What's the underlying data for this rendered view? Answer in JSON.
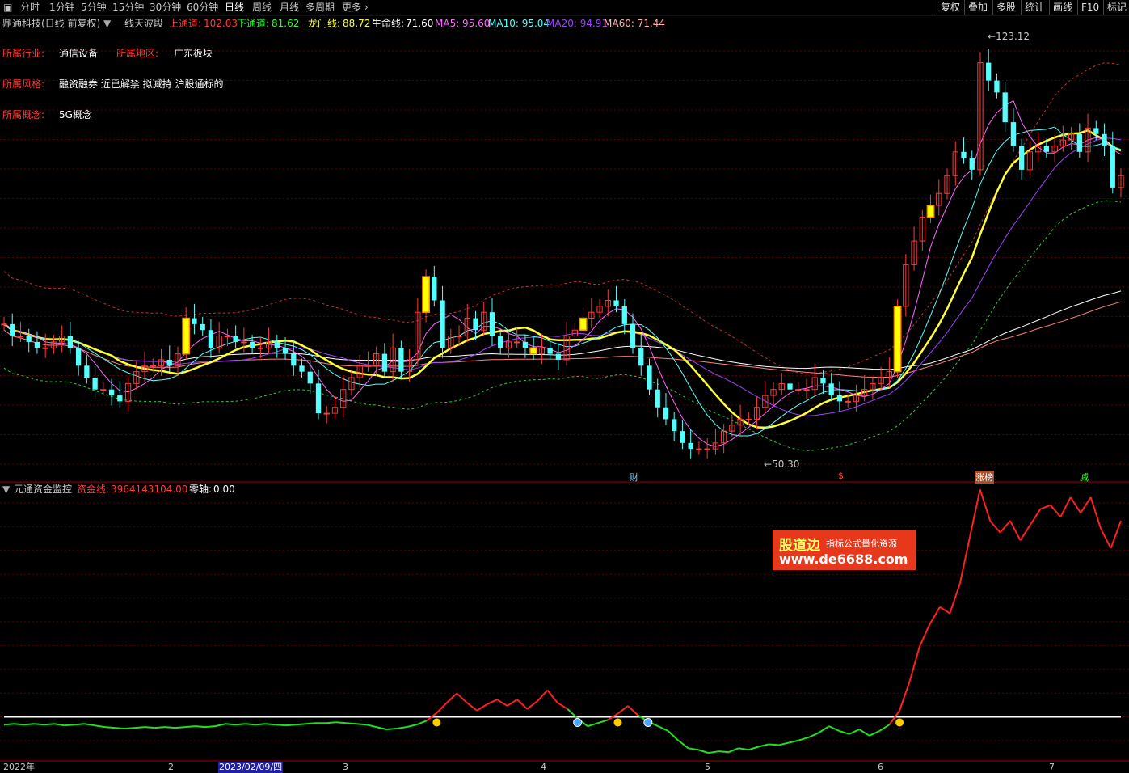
{
  "toolbar": {
    "periods": [
      "分时",
      "1分钟",
      "5分钟",
      "15分钟",
      "30分钟",
      "60分钟",
      "日线",
      "周线",
      "月线",
      "多周期",
      "更多"
    ],
    "active_period": "日线",
    "right_buttons": [
      "复权",
      "叠加",
      "多股",
      "统计",
      "画线",
      "F10",
      "标记"
    ]
  },
  "header": {
    "stock": "鼎通科技(日线 前复权)",
    "indicator": "一线天波段",
    "upper_label": "上通道:",
    "upper_value": "102.03",
    "lower_label": "下通道:",
    "lower_value": "81.62",
    "dragon_label": "龙门线:",
    "dragon_value": "88.72",
    "life_label": "生命线:",
    "life_value": "71.60",
    "ma5": "MA5: 95.60",
    "ma10": "MA10: 95.04",
    "ma20": "MA20: 94.91",
    "ma60": "MA60: 71.44"
  },
  "info": {
    "industry_label": "所属行业:",
    "industry": "通信设备",
    "region_label": "所属地区:",
    "region": "广东板块",
    "style_label": "所属风格:",
    "style": "融资融券 近已解禁 拟减持 沪股通标的",
    "concept_label": "所属概念:",
    "concept": "5G概念"
  },
  "chart_annotations": {
    "high": "123.12",
    "low": "50.30"
  },
  "event_markers": [
    "财",
    "$",
    "涨榜",
    "减"
  ],
  "sub_header": {
    "name": "元通资金监控",
    "fund_label": "资金线:",
    "fund_value": "3964143104.00",
    "zero_label": "零轴:",
    "zero_value": "0.00"
  },
  "watermark": {
    "title": "股道边",
    "subtitle": "指标公式量化资源",
    "url": "www.de6688.com"
  },
  "x_axis": [
    "2022年",
    "2",
    "2023/02/09/四",
    "3",
    "4",
    "5",
    "6",
    "7"
  ],
  "colors": {
    "up": "#ff3b3b",
    "down": "#54ffff",
    "ma5": "#ff66ff",
    "ma10": "#54ffff",
    "ma20": "#a040ff",
    "life": "#ffff33",
    "ma60": "#ffffff",
    "upper": "#c83232",
    "lower": "#32c832"
  },
  "chart_data": {
    "type": "candlestick+indicator",
    "price_range": [
      50.3,
      123.12
    ],
    "annotated_high": 123.12,
    "annotated_low": 50.3,
    "close_series": [
      74,
      72,
      72,
      71,
      70,
      70,
      71,
      72,
      70,
      67,
      65,
      63,
      63,
      62,
      61,
      64,
      66,
      67,
      67,
      68,
      67,
      69,
      75,
      74,
      73,
      70,
      72,
      72,
      71,
      71,
      70,
      70,
      71,
      70,
      69,
      67,
      66,
      64,
      59,
      59,
      60,
      63,
      65,
      67,
      67,
      69,
      66,
      70,
      66,
      68,
      76,
      82,
      78,
      70,
      72,
      72,
      75,
      73,
      76,
      72,
      70,
      71,
      71,
      70,
      69,
      70,
      69,
      68,
      72,
      73,
      75,
      76,
      77,
      78,
      77,
      74,
      70,
      67,
      63,
      60,
      58,
      56,
      54,
      53,
      53,
      53,
      54,
      56,
      57,
      58,
      58,
      60,
      62,
      63,
      64,
      63,
      63,
      63,
      65,
      64,
      62,
      61,
      61,
      62,
      63,
      64,
      65,
      66,
      77,
      84,
      88,
      92,
      94,
      96,
      99,
      103,
      102,
      100,
      118,
      115,
      113,
      108,
      104,
      100,
      103,
      104,
      103,
      104,
      105,
      106,
      103,
      107,
      106,
      104,
      97,
      99
    ],
    "fund_line": [
      -10,
      -9,
      -10,
      -9,
      -10,
      -9,
      -11,
      -10,
      -9,
      -11,
      -13,
      -14,
      -15,
      -14,
      -13,
      -14,
      -13,
      -14,
      -13,
      -12,
      -13,
      -12,
      -9,
      -10,
      -9,
      -10,
      -9,
      -10,
      -11,
      -10,
      -9,
      -8,
      -8,
      -7,
      -8,
      -9,
      -10,
      -13,
      -16,
      -15,
      -13,
      -10,
      -5,
      5,
      18,
      30,
      18,
      8,
      16,
      22,
      14,
      22,
      10,
      20,
      34,
      18,
      10,
      -2,
      -12,
      -8,
      -4,
      4,
      14,
      2,
      -6,
      -12,
      -18,
      -30,
      -40,
      -42,
      -46,
      -44,
      -45,
      -40,
      -42,
      -38,
      -35,
      -36,
      -33,
      -30,
      -26,
      -20,
      -12,
      -18,
      -22,
      -16,
      -24,
      -18,
      -10,
      8,
      45,
      90,
      118,
      140,
      132,
      170,
      230,
      290,
      250,
      235,
      250,
      225,
      245,
      265,
      270,
      255,
      280,
      260,
      280,
      240,
      215,
      250
    ],
    "zero_axis": 0
  }
}
